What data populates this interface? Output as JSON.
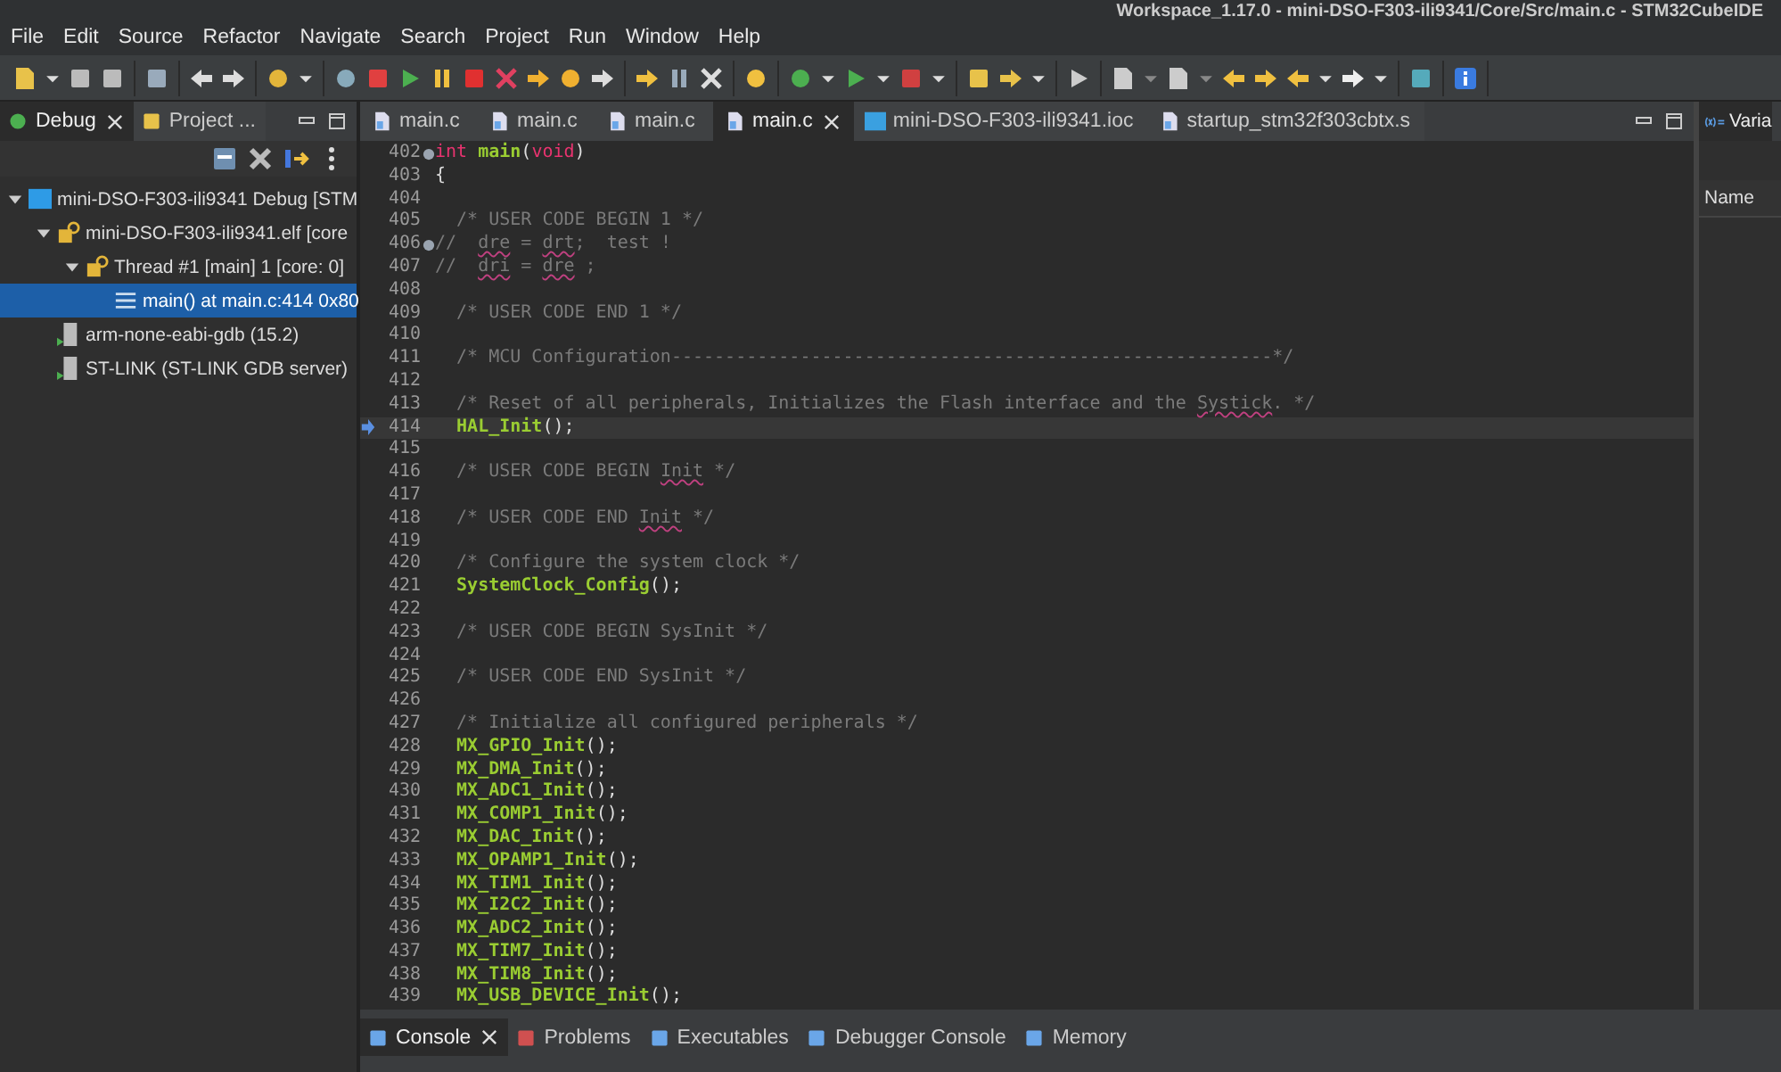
{
  "window": {
    "title": "Workspace_1.17.0 - mini-DSO-F303-ili9341/Core/Src/main.c - STM32CubeIDE"
  },
  "menu": [
    "File",
    "Edit",
    "Source",
    "Refactor",
    "Navigate",
    "Search",
    "Project",
    "Run",
    "Window",
    "Help"
  ],
  "debug_view": {
    "tabs": [
      {
        "label": "Debug",
        "kind": "debug",
        "selected": true
      },
      {
        "label": "Project ...",
        "kind": "project",
        "selected": false
      }
    ],
    "tree": [
      {
        "label": "mini-DSO-F303-ili9341 Debug [STM",
        "kind": "launch",
        "expanded": true,
        "selected": false,
        "children": [
          {
            "label": "mini-DSO-F303-ili9341.elf [core",
            "kind": "process",
            "expanded": true,
            "selected": false,
            "children": [
              {
                "label": "Thread #1 [main] 1 [core: 0]",
                "kind": "thread",
                "expanded": true,
                "selected": false,
                "children": [
                  {
                    "label": "main() at main.c:414 0x80",
                    "kind": "frame",
                    "selected": true
                  }
                ]
              }
            ]
          },
          {
            "label": "arm-none-eabi-gdb (15.2)",
            "kind": "gdb",
            "selected": false
          },
          {
            "label": "ST-LINK (ST-LINK GDB server)",
            "kind": "gdb",
            "selected": false
          }
        ]
      }
    ]
  },
  "editor": {
    "tabs": [
      {
        "label": "main.c",
        "kind": "c",
        "selected": false
      },
      {
        "label": "main.c",
        "kind": "c",
        "selected": false
      },
      {
        "label": "main.c",
        "kind": "c",
        "selected": false
      },
      {
        "label": "main.c",
        "kind": "c",
        "selected": true
      },
      {
        "label": "mini-DSO-F303-ili9341.ioc",
        "kind": "mx",
        "selected": false
      },
      {
        "label": "startup_stm32f303cbtx.s",
        "kind": "asm",
        "selected": false
      }
    ],
    "lines": [
      {
        "number": "402",
        "fold": true,
        "current": false,
        "tokens": [
          {
            "kind": "keyword",
            "text": "int"
          },
          {
            "kind": "function",
            "text": " main"
          },
          {
            "kind": "plain",
            "text": "("
          },
          {
            "kind": "keyword",
            "text": "void"
          },
          {
            "kind": "plain",
            "text": ")"
          }
        ]
      },
      {
        "number": "403",
        "fold": false,
        "current": false,
        "tokens": [
          {
            "kind": "plain",
            "text": "{"
          }
        ]
      },
      {
        "number": "404",
        "fold": false,
        "current": false
      },
      {
        "number": "405",
        "fold": false,
        "current": false,
        "tokens": [
          {
            "kind": "comment",
            "text": "  /* USER CODE BEGIN 1 */"
          }
        ]
      },
      {
        "number": "406",
        "fold": true,
        "current": false,
        "tokens": [
          {
            "kind": "comment",
            "text": "//  "
          },
          {
            "kind": "misspelled",
            "text": "dre"
          },
          {
            "kind": "comment",
            "text": " = "
          },
          {
            "kind": "misspelled",
            "text": "drt"
          },
          {
            "kind": "comment",
            "text": ";  test !"
          }
        ]
      },
      {
        "number": "407",
        "fold": false,
        "current": false,
        "tokens": [
          {
            "kind": "comment",
            "text": "//  "
          },
          {
            "kind": "misspelled",
            "text": "dri"
          },
          {
            "kind": "comment",
            "text": " = "
          },
          {
            "kind": "misspelled",
            "text": "dre"
          },
          {
            "kind": "comment",
            "text": " ;"
          }
        ]
      },
      {
        "number": "408",
        "fold": false,
        "current": false
      },
      {
        "number": "409",
        "fold": false,
        "current": false,
        "tokens": [
          {
            "kind": "comment",
            "text": "  /* USER CODE END 1 */"
          }
        ]
      },
      {
        "number": "410",
        "fold": false,
        "current": false
      },
      {
        "number": "411",
        "fold": false,
        "current": false,
        "tokens": [
          {
            "kind": "comment",
            "text": "  /* MCU Configuration--------------------------------------------------------*/"
          }
        ]
      },
      {
        "number": "412",
        "fold": false,
        "current": false
      },
      {
        "number": "413",
        "fold": false,
        "current": false,
        "tokens": [
          {
            "kind": "comment",
            "text": "  /* Reset of all peripherals, Initializes the Flash interface and the "
          },
          {
            "kind": "misspelled",
            "text": "Systick"
          },
          {
            "kind": "comment",
            "text": ". */"
          }
        ]
      },
      {
        "number": "414",
        "fold": false,
        "current": true,
        "tokens": [
          {
            "kind": "function",
            "text": "  HAL_Init"
          },
          {
            "kind": "plain",
            "text": "();"
          }
        ]
      },
      {
        "number": "415",
        "fold": false,
        "current": false
      },
      {
        "number": "416",
        "fold": false,
        "current": false,
        "tokens": [
          {
            "kind": "comment",
            "text": "  /* USER CODE BEGIN "
          },
          {
            "kind": "misspelled",
            "text": "Init"
          },
          {
            "kind": "comment",
            "text": " */"
          }
        ]
      },
      {
        "number": "417",
        "fold": false,
        "current": false
      },
      {
        "number": "418",
        "fold": false,
        "current": false,
        "tokens": [
          {
            "kind": "comment",
            "text": "  /* USER CODE END "
          },
          {
            "kind": "misspelled",
            "text": "Init"
          },
          {
            "kind": "comment",
            "text": " */"
          }
        ]
      },
      {
        "number": "419",
        "fold": false,
        "current": false
      },
      {
        "number": "420",
        "fold": false,
        "current": false,
        "tokens": [
          {
            "kind": "comment",
            "text": "  /* Configure the system clock */"
          }
        ]
      },
      {
        "number": "421",
        "fold": false,
        "current": false,
        "tokens": [
          {
            "kind": "function",
            "text": "  SystemClock_Config"
          },
          {
            "kind": "plain",
            "text": "();"
          }
        ]
      },
      {
        "number": "422",
        "fold": false,
        "current": false
      },
      {
        "number": "423",
        "fold": false,
        "current": false,
        "tokens": [
          {
            "kind": "comment",
            "text": "  /* USER CODE BEGIN SysInit */"
          }
        ]
      },
      {
        "number": "424",
        "fold": false,
        "current": false
      },
      {
        "number": "425",
        "fold": false,
        "current": false,
        "tokens": [
          {
            "kind": "comment",
            "text": "  /* USER CODE END SysInit */"
          }
        ]
      },
      {
        "number": "426",
        "fold": false,
        "current": false
      },
      {
        "number": "427",
        "fold": false,
        "current": false,
        "tokens": [
          {
            "kind": "comment",
            "text": "  /* Initialize all configured peripherals */"
          }
        ]
      },
      {
        "number": "428",
        "fold": false,
        "current": false,
        "tokens": [
          {
            "kind": "function",
            "text": "  MX_GPIO_Init"
          },
          {
            "kind": "plain",
            "text": "();"
          }
        ]
      },
      {
        "number": "429",
        "fold": false,
        "current": false,
        "tokens": [
          {
            "kind": "function",
            "text": "  MX_DMA_Init"
          },
          {
            "kind": "plain",
            "text": "();"
          }
        ]
      },
      {
        "number": "430",
        "fold": false,
        "current": false,
        "tokens": [
          {
            "kind": "function",
            "text": "  MX_ADC1_Init"
          },
          {
            "kind": "plain",
            "text": "();"
          }
        ]
      },
      {
        "number": "431",
        "fold": false,
        "current": false,
        "tokens": [
          {
            "kind": "function",
            "text": "  MX_COMP1_Init"
          },
          {
            "kind": "plain",
            "text": "();"
          }
        ]
      },
      {
        "number": "432",
        "fold": false,
        "current": false,
        "tokens": [
          {
            "kind": "function",
            "text": "  MX_DAC_Init"
          },
          {
            "kind": "plain",
            "text": "();"
          }
        ]
      },
      {
        "number": "433",
        "fold": false,
        "current": false,
        "tokens": [
          {
            "kind": "function",
            "text": "  MX_OPAMP1_Init"
          },
          {
            "kind": "plain",
            "text": "();"
          }
        ]
      },
      {
        "number": "434",
        "fold": false,
        "current": false,
        "tokens": [
          {
            "kind": "function",
            "text": "  MX_TIM1_Init"
          },
          {
            "kind": "plain",
            "text": "();"
          }
        ]
      },
      {
        "number": "435",
        "fold": false,
        "current": false,
        "tokens": [
          {
            "kind": "function",
            "text": "  MX_I2C2_Init"
          },
          {
            "kind": "plain",
            "text": "();"
          }
        ]
      },
      {
        "number": "436",
        "fold": false,
        "current": false,
        "tokens": [
          {
            "kind": "function",
            "text": "  MX_ADC2_Init"
          },
          {
            "kind": "plain",
            "text": "();"
          }
        ]
      },
      {
        "number": "437",
        "fold": false,
        "current": false,
        "tokens": [
          {
            "kind": "function",
            "text": "  MX_TIM7_Init"
          },
          {
            "kind": "plain",
            "text": "();"
          }
        ]
      },
      {
        "number": "438",
        "fold": false,
        "current": false,
        "tokens": [
          {
            "kind": "function",
            "text": "  MX_TIM8_Init"
          },
          {
            "kind": "plain",
            "text": "();"
          }
        ]
      },
      {
        "number": "439",
        "fold": false,
        "current": false,
        "tokens": [
          {
            "kind": "function",
            "text": "  MX_USB_DEVICE_Init"
          },
          {
            "kind": "plain",
            "text": "();"
          }
        ]
      }
    ]
  },
  "variables_view": {
    "tab": "Varia",
    "column": "Name"
  },
  "bottom_panel": {
    "tabs": [
      {
        "label": "Console",
        "kind": "console",
        "selected": true
      },
      {
        "label": "Problems",
        "kind": "problems",
        "selected": false
      },
      {
        "label": "Executables",
        "kind": "executables",
        "selected": false
      },
      {
        "label": "Debugger Console",
        "kind": "debugger",
        "selected": false
      },
      {
        "label": "Memory",
        "kind": "memory",
        "selected": false
      }
    ]
  }
}
